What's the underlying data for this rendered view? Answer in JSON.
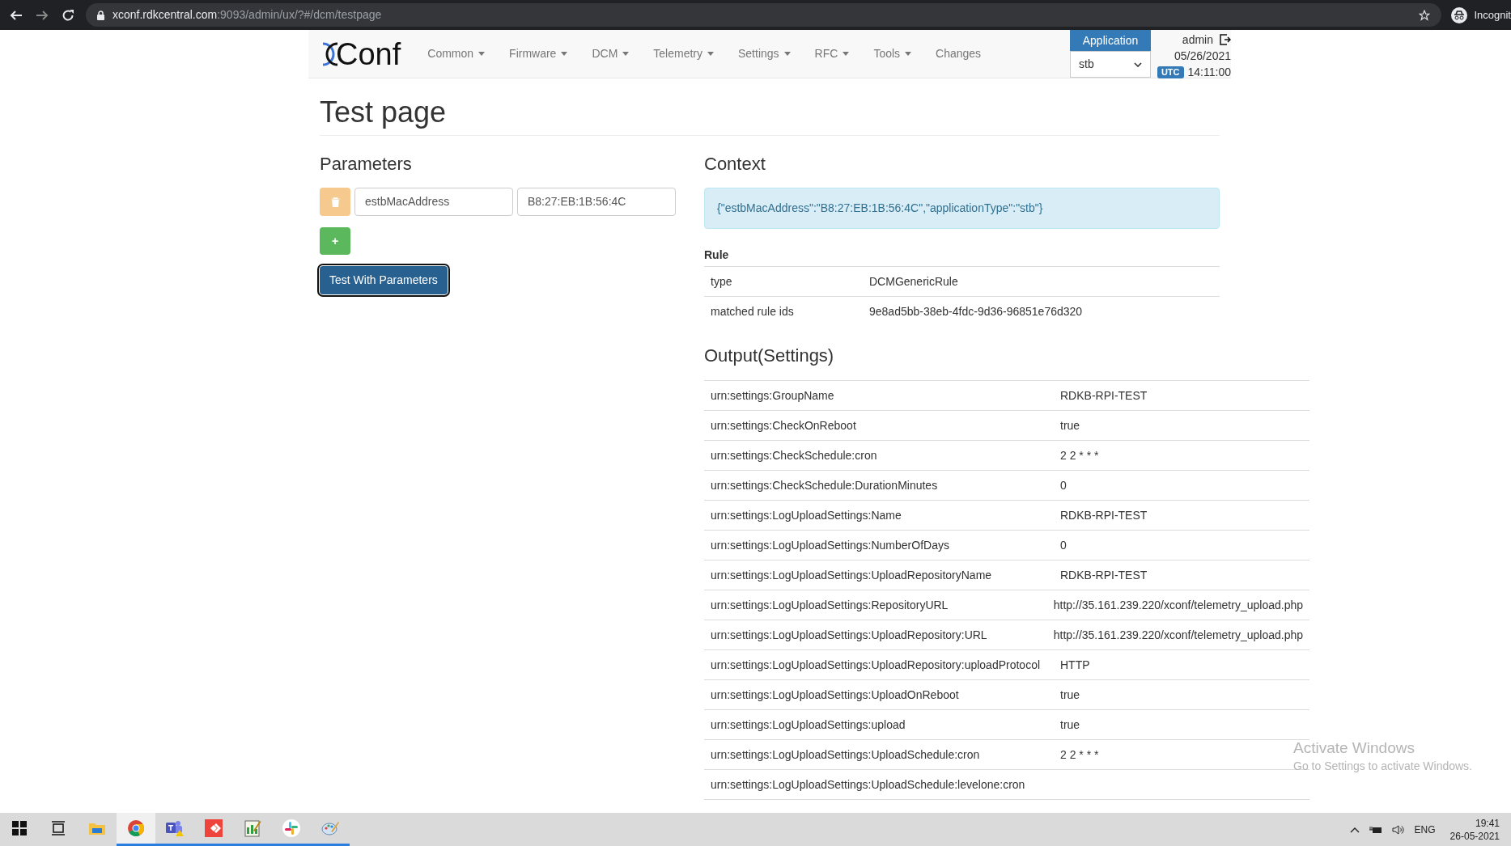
{
  "browser": {
    "url_host": "xconf.rdkcentral.com",
    "url_path": ":9093/admin/ux/?#/dcm/testpage",
    "profile_label": "Incognit"
  },
  "nav": {
    "logo_text": "Conf",
    "items": [
      {
        "label": "Common",
        "dropdown": true
      },
      {
        "label": "Firmware",
        "dropdown": true
      },
      {
        "label": "DCM",
        "dropdown": true
      },
      {
        "label": "Telemetry",
        "dropdown": true
      },
      {
        "label": "Settings",
        "dropdown": true
      },
      {
        "label": "RFC",
        "dropdown": true
      },
      {
        "label": "Tools",
        "dropdown": true
      },
      {
        "label": "Changes",
        "dropdown": false
      }
    ],
    "application_label": "Application",
    "application_value": "stb",
    "user": "admin",
    "date": "05/26/2021",
    "timezone": "UTC",
    "time": "14:11:00"
  },
  "page": {
    "title": "Test page"
  },
  "parameters": {
    "heading": "Parameters",
    "rows": [
      {
        "key": "estbMacAddress",
        "value": "B8:27:EB:1B:56:4C"
      }
    ],
    "add_button": "+",
    "submit_button": "Test With Parameters"
  },
  "context": {
    "heading": "Context",
    "json": "{\"estbMacAddress\":\"B8:27:EB:1B:56:4C\",\"applicationType\":\"stb\"}"
  },
  "rule": {
    "heading": "Rule",
    "rows": [
      {
        "label": "type",
        "value": "DCMGenericRule"
      },
      {
        "label": "matched rule ids",
        "value": "9e8ad5bb-38eb-4fdc-9d36-96851e76d320"
      }
    ]
  },
  "output": {
    "heading": "Output(Settings)",
    "rows": [
      {
        "key": "urn:settings:GroupName",
        "value": "RDKB-RPI-TEST"
      },
      {
        "key": "urn:settings:CheckOnReboot",
        "value": "true"
      },
      {
        "key": "urn:settings:CheckSchedule:cron",
        "value": "2 2 * * *"
      },
      {
        "key": "urn:settings:CheckSchedule:DurationMinutes",
        "value": "0"
      },
      {
        "key": "urn:settings:LogUploadSettings:Name",
        "value": "RDKB-RPI-TEST"
      },
      {
        "key": "urn:settings:LogUploadSettings:NumberOfDays",
        "value": "0"
      },
      {
        "key": "urn:settings:LogUploadSettings:UploadRepositoryName",
        "value": "RDKB-RPI-TEST"
      },
      {
        "key": "urn:settings:LogUploadSettings:RepositoryURL",
        "value": "http://35.161.239.220/xconf/telemetry_upload.php"
      },
      {
        "key": "urn:settings:LogUploadSettings:UploadRepository:URL",
        "value": "http://35.161.239.220/xconf/telemetry_upload.php"
      },
      {
        "key": "urn:settings:LogUploadSettings:UploadRepository:uploadProtocol",
        "value": "HTTP"
      },
      {
        "key": "urn:settings:LogUploadSettings:UploadOnReboot",
        "value": "true"
      },
      {
        "key": "urn:settings:LogUploadSettings:upload",
        "value": "true"
      },
      {
        "key": "urn:settings:LogUploadSettings:UploadSchedule:cron",
        "value": "2 2 * * *"
      },
      {
        "key": "urn:settings:LogUploadSettings:UploadSchedule:levelone:cron"
      }
    ]
  },
  "watermark": {
    "title": "Activate Windows",
    "subtitle": "Go to Settings to activate Windows."
  },
  "taskbar": {
    "apps": [
      {
        "kind": "start",
        "running": false,
        "selected": false
      },
      {
        "kind": "taskview",
        "running": false,
        "selected": false
      },
      {
        "kind": "explorer",
        "running": false,
        "selected": false
      },
      {
        "kind": "chrome",
        "running": true,
        "selected": true
      },
      {
        "kind": "teams",
        "running": true,
        "selected": false
      },
      {
        "kind": "remote",
        "running": true,
        "selected": false
      },
      {
        "kind": "editor",
        "running": true,
        "selected": false
      },
      {
        "kind": "slack",
        "running": true,
        "selected": false
      },
      {
        "kind": "paint",
        "running": true,
        "selected": false
      }
    ],
    "language": "ENG",
    "time": "19:41",
    "date": "26-05-2021"
  }
}
